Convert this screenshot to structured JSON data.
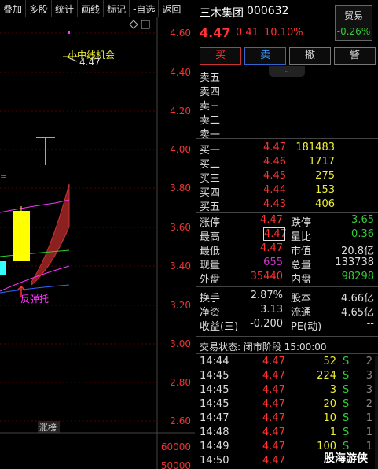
{
  "toolbar": {
    "items": [
      "叠加",
      "多股",
      "统计",
      "画线",
      "标记",
      "-自选",
      "返回"
    ]
  },
  "chart": {
    "y_ticks": [
      "4.60",
      "4.40",
      "4.20",
      "4.00",
      "3.80",
      "3.60",
      "3.40",
      "3.20",
      "3.00",
      "2.80",
      "2.60"
    ],
    "vol_ticks": [
      "60000",
      "50000"
    ],
    "annotation_signal": "小中线机会",
    "annotation_price": "4.47",
    "annotation_rebound": "反弹托",
    "limit_badge": "涨榜",
    "corner_icon": "diamond-icon",
    "colors": {
      "rise": "#ff3333",
      "yellow_candle": "#ffff00",
      "band_fill": "#8b2020",
      "ma_magenta": "#ff33ff",
      "ma_green": "#33cc33",
      "ma_blue": "#3366ff"
    }
  },
  "quote": {
    "name": "三木集团",
    "code": "000632",
    "price": "4.47",
    "change": "0.41",
    "change_pct": "10.10%",
    "trade_label": "贸易",
    "trade_pct": "-0.26%"
  },
  "actions": {
    "buy": "买",
    "sell": "卖",
    "cancel": "撤",
    "warn": "警"
  },
  "order_book": {
    "asks": [
      {
        "label": "卖五",
        "price": "",
        "volume": ""
      },
      {
        "label": "卖四",
        "price": "",
        "volume": ""
      },
      {
        "label": "卖三",
        "price": "",
        "volume": ""
      },
      {
        "label": "卖二",
        "price": "",
        "volume": ""
      },
      {
        "label": "卖一",
        "price": "",
        "volume": ""
      }
    ],
    "bids": [
      {
        "label": "买一",
        "price": "4.47",
        "volume": "181483"
      },
      {
        "label": "买二",
        "price": "4.46",
        "volume": "1717"
      },
      {
        "label": "买三",
        "price": "4.45",
        "volume": "275"
      },
      {
        "label": "买四",
        "price": "4.44",
        "volume": "153"
      },
      {
        "label": "买五",
        "price": "4.43",
        "volume": "406"
      }
    ]
  },
  "stats": [
    {
      "l1": "涨停",
      "v1": "4.47",
      "c1": "#ff3333",
      "l2": "跌停",
      "v2": "3.65",
      "c2": "#33cc33"
    },
    {
      "l1": "最高",
      "v1": "4.47",
      "c1": "#ff3333",
      "l2": "量比",
      "v2": "0.36",
      "c2": "#33cc33"
    },
    {
      "l1": "最低",
      "v1": "4.47",
      "c1": "#ff3333",
      "l2": "市值",
      "v2": "20.8亿",
      "c2": "#dddddd"
    },
    {
      "l1": "现量",
      "v1": "655",
      "c1": "#cc33cc",
      "l2": "总量",
      "v2": "133738",
      "c2": "#dddddd"
    },
    {
      "l1": "外盘",
      "v1": "35440",
      "c1": "#ff3333",
      "l2": "内盘",
      "v2": "98298",
      "c2": "#33cc33"
    },
    {
      "l1": "换手",
      "v1": "2.87%",
      "c1": "#dddddd",
      "l2": "股本",
      "v2": "4.66亿",
      "c2": "#dddddd"
    },
    {
      "l1": "净资",
      "v1": "3.13",
      "c1": "#dddddd",
      "l2": "流通",
      "v2": "4.65亿",
      "c2": "#dddddd"
    },
    {
      "l1": "收益(三)",
      "v1": "-0.200",
      "c1": "#dddddd",
      "l2": "PE(动)",
      "v2": "--",
      "c2": "#dddddd"
    }
  ],
  "status": {
    "text": "交易状态: 闭市阶段 15:00:00"
  },
  "ticks": [
    {
      "time": "14:44",
      "price": "4.47",
      "vol": "52",
      "side": "S",
      "n": "2"
    },
    {
      "time": "14:45",
      "price": "4.47",
      "vol": "224",
      "side": "S",
      "n": "3"
    },
    {
      "time": "14:45",
      "price": "4.47",
      "vol": "3",
      "side": "S",
      "n": "3"
    },
    {
      "time": "14:45",
      "price": "4.47",
      "vol": "20",
      "side": "S",
      "n": "2"
    },
    {
      "time": "14:47",
      "price": "4.47",
      "vol": "10",
      "side": "S",
      "n": "1"
    },
    {
      "time": "14:48",
      "price": "4.47",
      "vol": "1",
      "side": "S",
      "n": "1"
    },
    {
      "time": "14:49",
      "price": "4.47",
      "vol": "100",
      "side": "S",
      "n": "1"
    },
    {
      "time": "14:50",
      "price": "4.47",
      "vol": "",
      "side": "",
      "n": ""
    }
  ],
  "watermark": "股海游侠"
}
